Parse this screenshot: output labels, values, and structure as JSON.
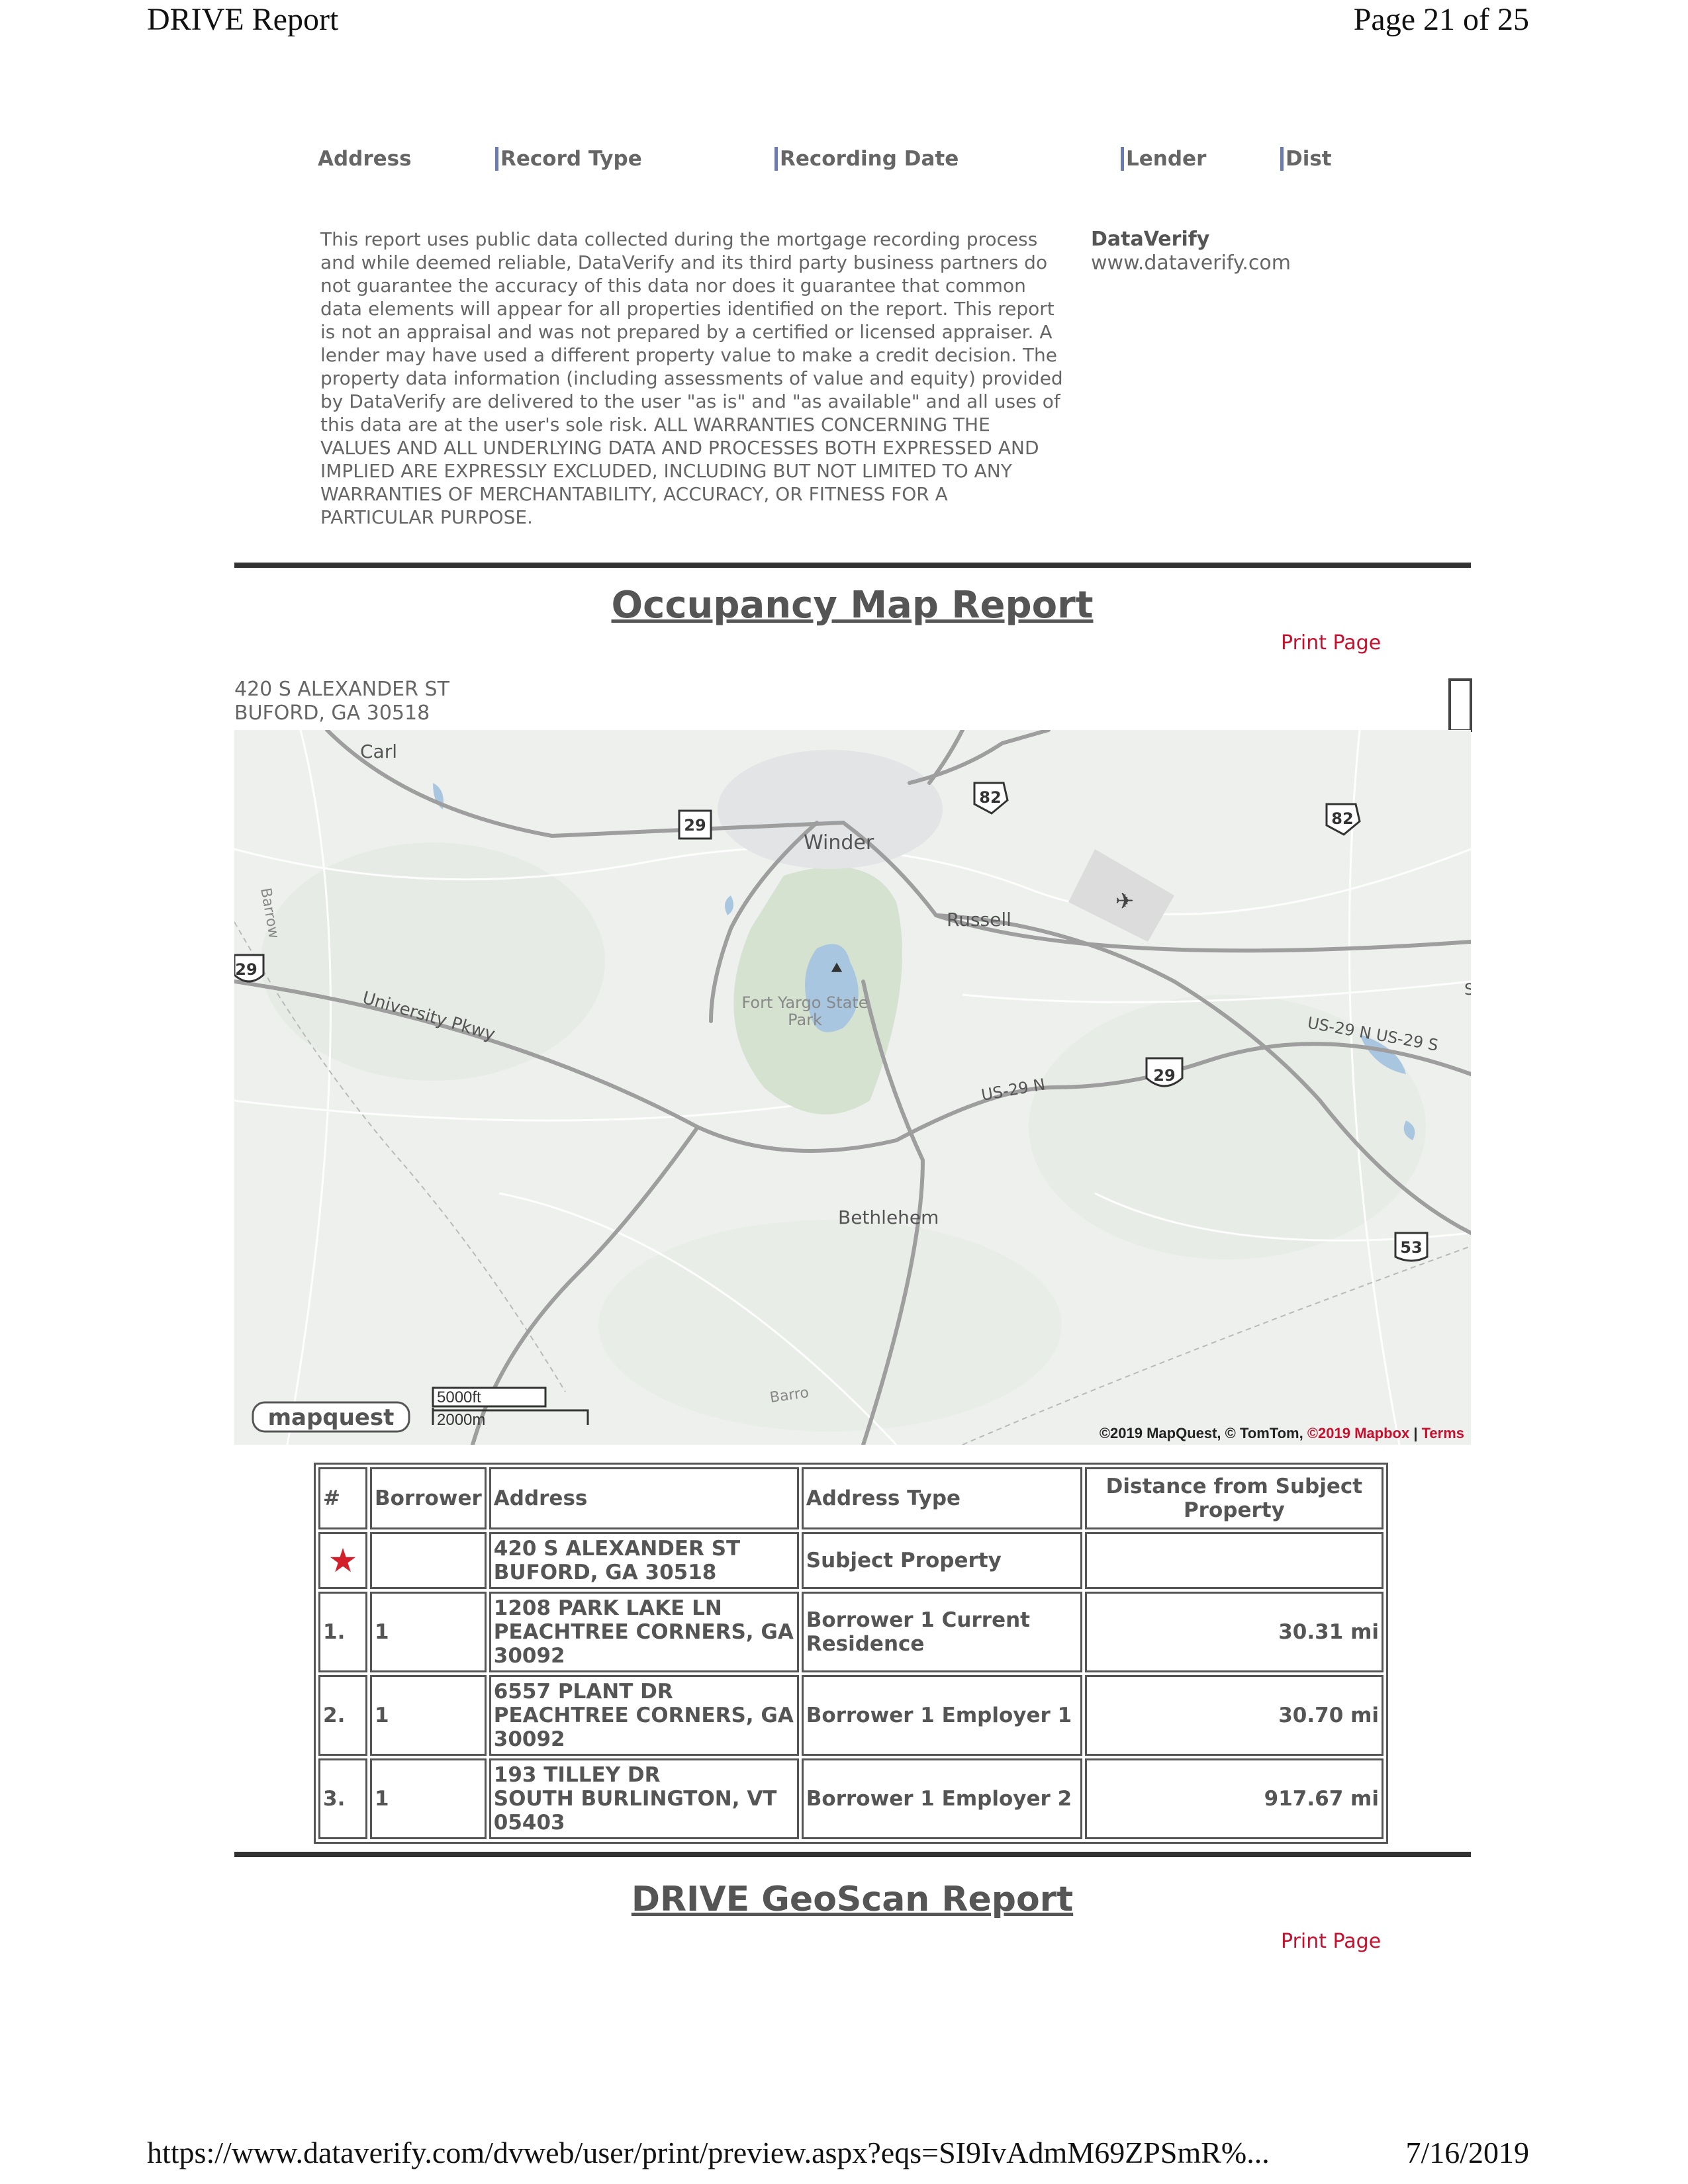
{
  "header": {
    "title": "DRIVE Report",
    "page": "Page 21 of 25"
  },
  "record_columns": [
    "Address",
    "Record Type",
    "Recording Date",
    "Lender",
    "Dist"
  ],
  "disclaimer": "This report uses public data collected during the mortgage recording process and while deemed reliable, DataVerify and its third party business partners do not guarantee the accuracy of this data nor does it guarantee that common data elements will appear for all properties identified on the report.  This report is not an appraisal and was not prepared by a certified or licensed appraiser.  A lender may have used a different property value to make a credit decision.  The property data information (including assessments of value and equity) provided by DataVerify are delivered to the user \"as is\" and \"as available\" and all uses of this data are at the user's sole risk.  ALL WARRANTIES CONCERNING THE VALUES AND ALL UNDERLYING DATA AND PROCESSES BOTH EXPRESSED AND IMPLIED ARE EXPRESSLY EXCLUDED, INCLUDING BUT NOT LIMITED TO ANY WARRANTIES OF MERCHANTABILITY, ACCURACY, OR FITNESS FOR A PARTICULAR PURPOSE.",
  "brand": {
    "name": "DataVerify",
    "url": "www.dataverify.com"
  },
  "occupancy": {
    "title": "Occupancy Map Report",
    "print": "Print Page",
    "address_line1": "420 S ALEXANDER ST",
    "address_line2": "BUFORD, GA 30518"
  },
  "map": {
    "places": {
      "carl": "Carl",
      "winder": "Winder",
      "russell": "Russell",
      "bethlehem": "Bethlehem",
      "park1": "Fort Yargo State",
      "park2": "Park",
      "barrow": "Barrow",
      "barrow2": "Barro",
      "univ": "University Pkwy",
      "us29n": "US-29 N",
      "us29ns": "US-29 N US-29 S",
      "s": "S"
    },
    "shields": {
      "r29a": "29",
      "r82a": "82",
      "r82b": "82",
      "r29b": "29",
      "r29c": "29",
      "r53": "53"
    },
    "scale_ft": "5000ft",
    "scale_m": "2000m",
    "logo": "mapquest",
    "copyright_a": "©2019 MapQuest, © TomTom, ",
    "copyright_b": "©2019 Mapbox",
    "copyright_sep": " | ",
    "copyright_terms": "Terms"
  },
  "table": {
    "headers": {
      "num": "#",
      "borrower": "Borrower",
      "address": "Address",
      "type": "Address Type",
      "distance": "Distance from Subject Property"
    },
    "subject": {
      "addr1": "420 S ALEXANDER ST",
      "addr2": "BUFORD, GA 30518",
      "type": "Subject Property"
    },
    "rows": [
      {
        "num": "1.",
        "borrower": "1",
        "addr1": "1208 PARK LAKE LN",
        "addr2": "PEACHTREE CORNERS, GA",
        "addr3": "30092",
        "type": "Borrower 1 Current Residence",
        "distance": "30.31 mi"
      },
      {
        "num": "2.",
        "borrower": "1",
        "addr1": "6557 PLANT DR",
        "addr2": "PEACHTREE CORNERS, GA",
        "addr3": "30092",
        "type": "Borrower 1 Employer 1",
        "distance": "30.70 mi"
      },
      {
        "num": "3.",
        "borrower": "1",
        "addr1": "193 TILLEY DR",
        "addr2": "SOUTH BURLINGTON, VT",
        "addr3": "05403",
        "type": "Borrower 1 Employer 2",
        "distance": "917.67 mi"
      }
    ]
  },
  "geoscan": {
    "title": "DRIVE GeoScan Report",
    "print": "Print Page"
  },
  "footer": {
    "url": "https://www.dataverify.com/dvweb/user/print/preview.aspx?eqs=SI9IvAdmM69ZPSmR%...",
    "date": "7/16/2019"
  },
  "colors": {
    "accent_red": "#c8102e",
    "text_gray": "#555555"
  }
}
